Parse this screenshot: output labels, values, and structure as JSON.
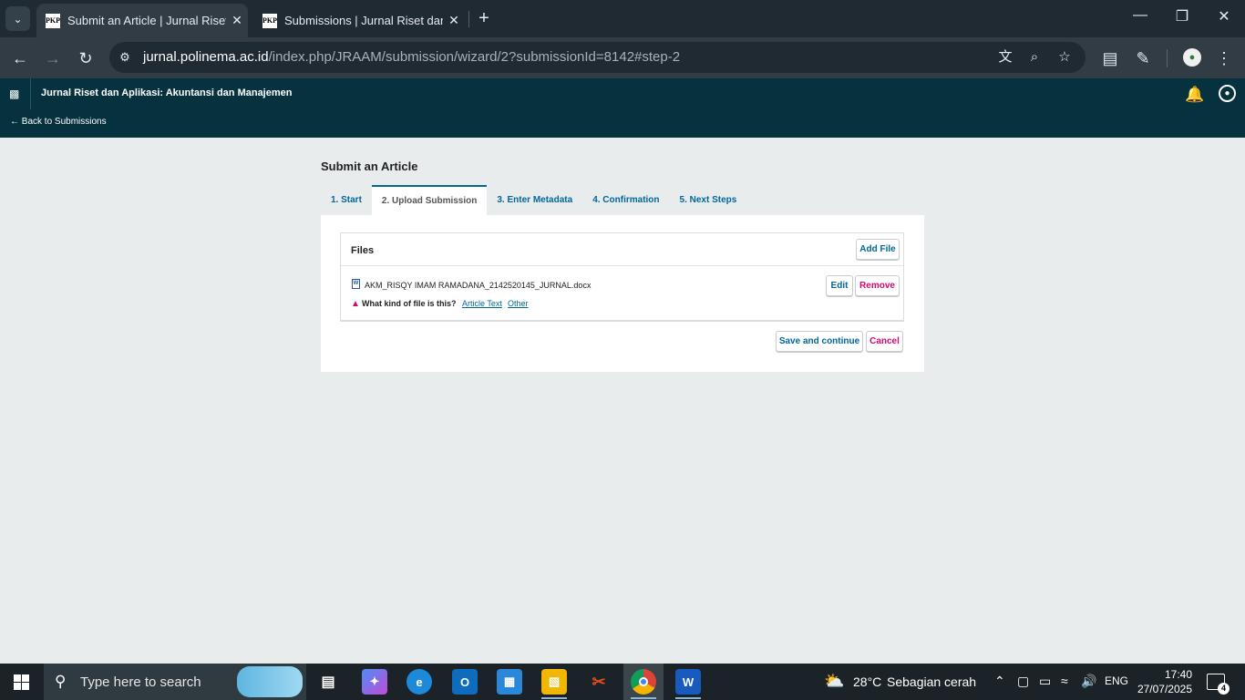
{
  "browser": {
    "tabs": [
      {
        "title": "Submit an Article | Jurnal Riset d",
        "favicon": "PKP"
      },
      {
        "title": "Submissions | Jurnal Riset dan Ap",
        "favicon": "PKP"
      }
    ],
    "url_domain": "jurnal.polinema.ac.id",
    "url_path": "/index.php/JRAAM/submission/wizard/2?submissionId=8142#step-2"
  },
  "app": {
    "journal_title": "Jurnal Riset dan Aplikasi: Akuntansi dan Manajemen",
    "back_link": "Back to Submissions"
  },
  "page": {
    "title": "Submit an Article",
    "steps": [
      "1. Start",
      "2. Upload Submission",
      "3. Enter Metadata",
      "4. Confirmation",
      "5. Next Steps"
    ],
    "active_step": 1,
    "files": {
      "title": "Files",
      "add_label": "Add File",
      "file_name": "AKM_RISQY IMAM RAMADANA_2142520145_JURNAL.docx",
      "file_icon_letter": "W",
      "edit_label": "Edit",
      "remove_label": "Remove",
      "question": "What kind of file is this?",
      "options": [
        "Article Text",
        "Other"
      ]
    },
    "save_label": "Save and continue",
    "cancel_label": "Cancel"
  },
  "taskbar": {
    "search_placeholder": "Type here to search",
    "weather_temp": "28°C",
    "weather_desc": "Sebagian cerah",
    "language": "ENG",
    "time": "17:40",
    "date": "27/07/2025",
    "notification_count": "4"
  },
  "colors": {
    "header_bg": "#06323f",
    "link": "#006798",
    "danger": "#d00a6c"
  }
}
